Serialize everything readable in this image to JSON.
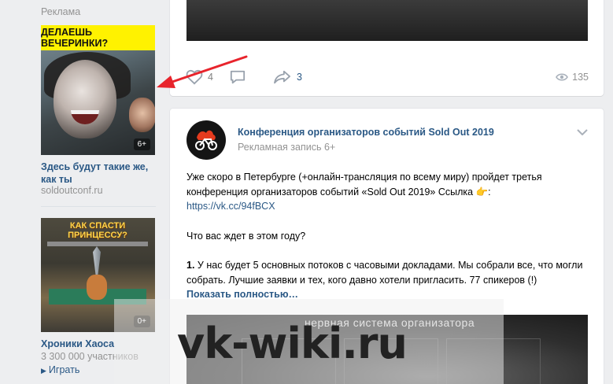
{
  "ads": {
    "header": "Реклама",
    "ad1": {
      "banner_text": "ДЕЛАЕШЬ ВЕЧЕРИНКИ?",
      "age_badge": "6+",
      "title": "Здесь будут такие же, как ты",
      "domain": "soldoutconf.ru"
    },
    "ad2": {
      "image_title": "КАК СПАСТИ ПРИНЦЕССУ?",
      "age_badge": "0+",
      "title": "Хроники Хаоса",
      "members": "3 300 000 участников",
      "play_label": "Играть"
    }
  },
  "post1": {
    "likes": "4",
    "shares": "3",
    "views": "135"
  },
  "post2": {
    "author": "Конференция организаторов событий Sold Out 2019",
    "subtitle": "Рекламная запись 6+",
    "line1": "Уже скоро в Петербурге (+онлайн-трансляция по всему миру) пройдет третья конференция организаторов событий «Sold Out 2019» Ссылка",
    "hand_emoji": "👉",
    "line1_tail": ":",
    "link": "https://vk.cc/94fBCX",
    "question": "Что вас ждет в этом году?",
    "point_num": "1.",
    "point_text": "У нас будет 5 основных потоков с часовыми докладами. Мы собрали все, что могли собрать. Лучшие заявки и тех, кого давно хотели пригласить. 77 спикеров (!)",
    "show_more": "Показать полностью…",
    "media_title": "нервная система организатора"
  },
  "watermark": "vk-wiki.ru",
  "colors": {
    "link": "#2a5885",
    "muted": "#939393",
    "background": "#edeef0",
    "arrow": "#e8242c",
    "banner_yellow": "#fff200"
  },
  "icons": [
    "heart-icon",
    "comment-icon",
    "share-icon",
    "eye-icon",
    "chevron-down-icon",
    "play-icon",
    "arrow-annotation"
  ]
}
